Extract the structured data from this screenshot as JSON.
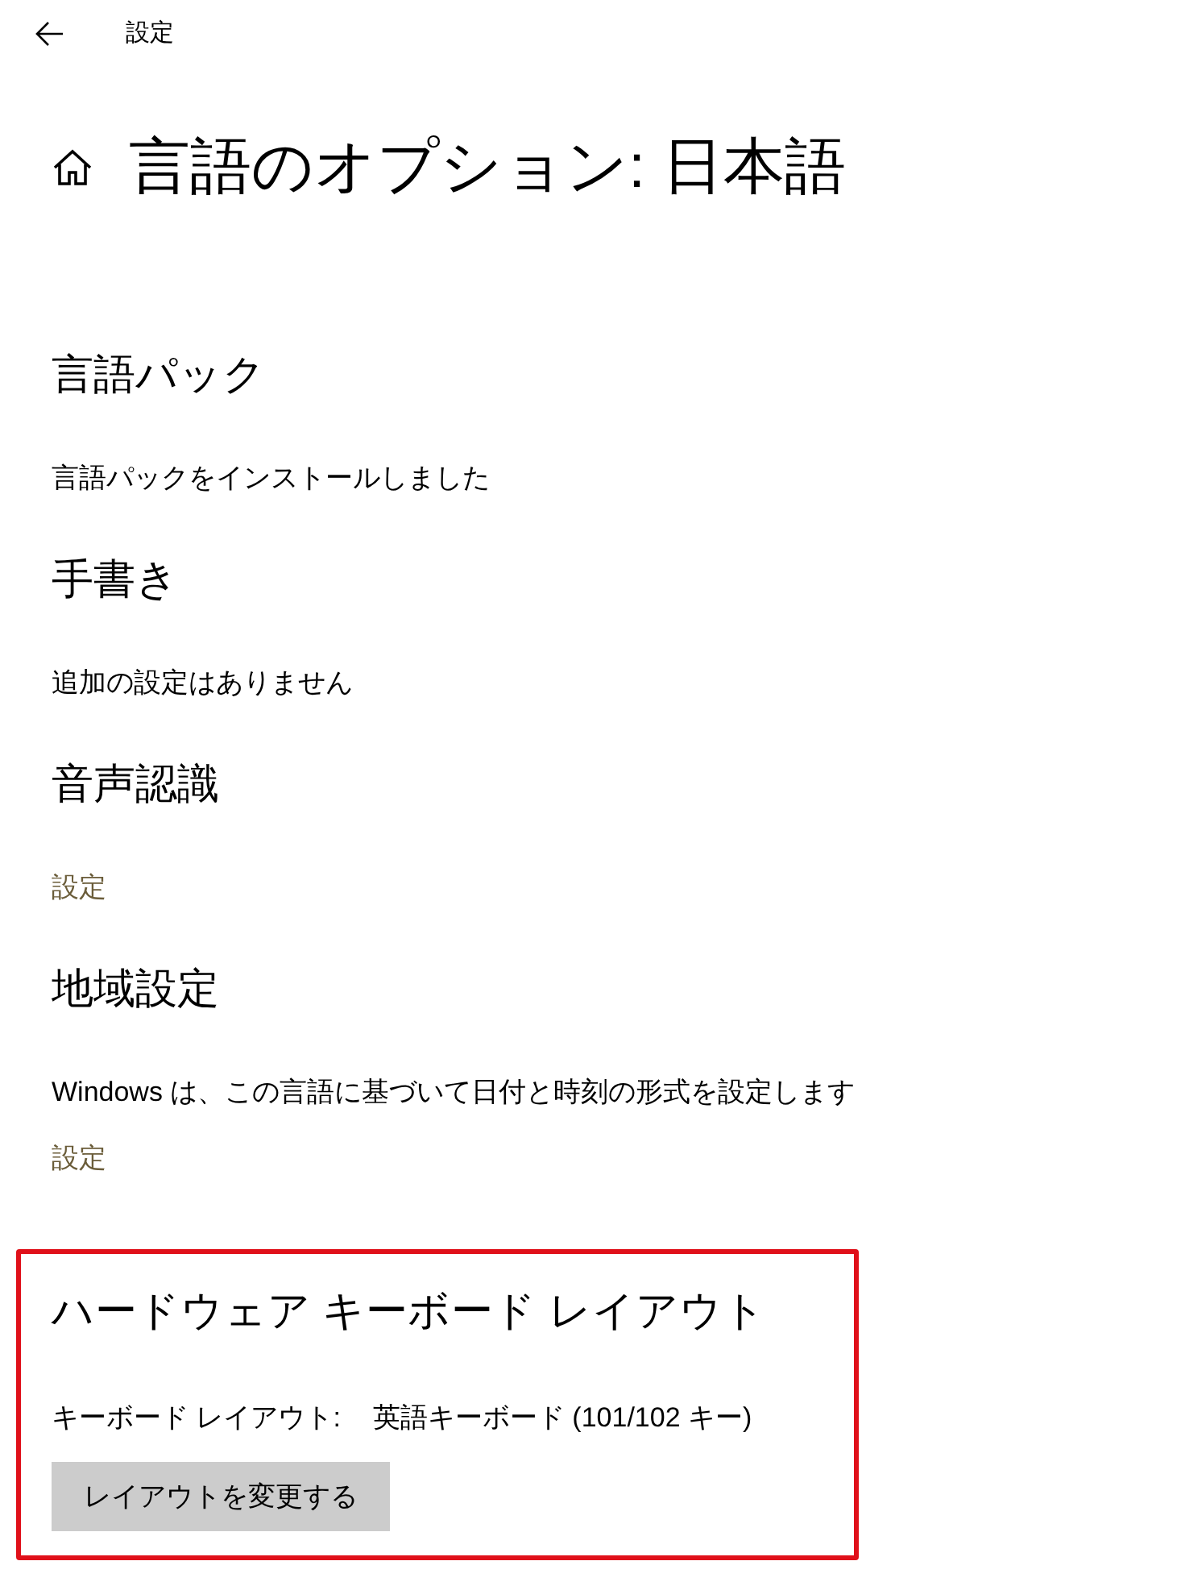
{
  "top_bar": {
    "title": "設定"
  },
  "page": {
    "title": "言語のオプション: 日本語"
  },
  "sections": [
    {
      "heading": "言語パック",
      "highlighted": false,
      "items": [
        {
          "kind": "text",
          "text": "言語パックをインストールしました"
        }
      ]
    },
    {
      "heading": "手書き",
      "highlighted": false,
      "items": [
        {
          "kind": "text",
          "text": "追加の設定はありません"
        }
      ]
    },
    {
      "heading": "音声認識",
      "highlighted": false,
      "items": [
        {
          "kind": "link",
          "text": "設定"
        }
      ]
    },
    {
      "heading": "地域設定",
      "highlighted": false,
      "items": [
        {
          "kind": "text",
          "text": "Windows は、この言語に基づいて日付と時刻の形式を設定します"
        },
        {
          "kind": "link",
          "text": "設定"
        }
      ]
    },
    {
      "heading": "ハードウェア キーボード レイアウト",
      "highlighted": true,
      "items": [
        {
          "kind": "pair",
          "label": "キーボード レイアウト:",
          "value": "英語キーボード (101/102 キー)"
        },
        {
          "kind": "button",
          "text": "レイアウトを変更する"
        }
      ]
    }
  ]
}
